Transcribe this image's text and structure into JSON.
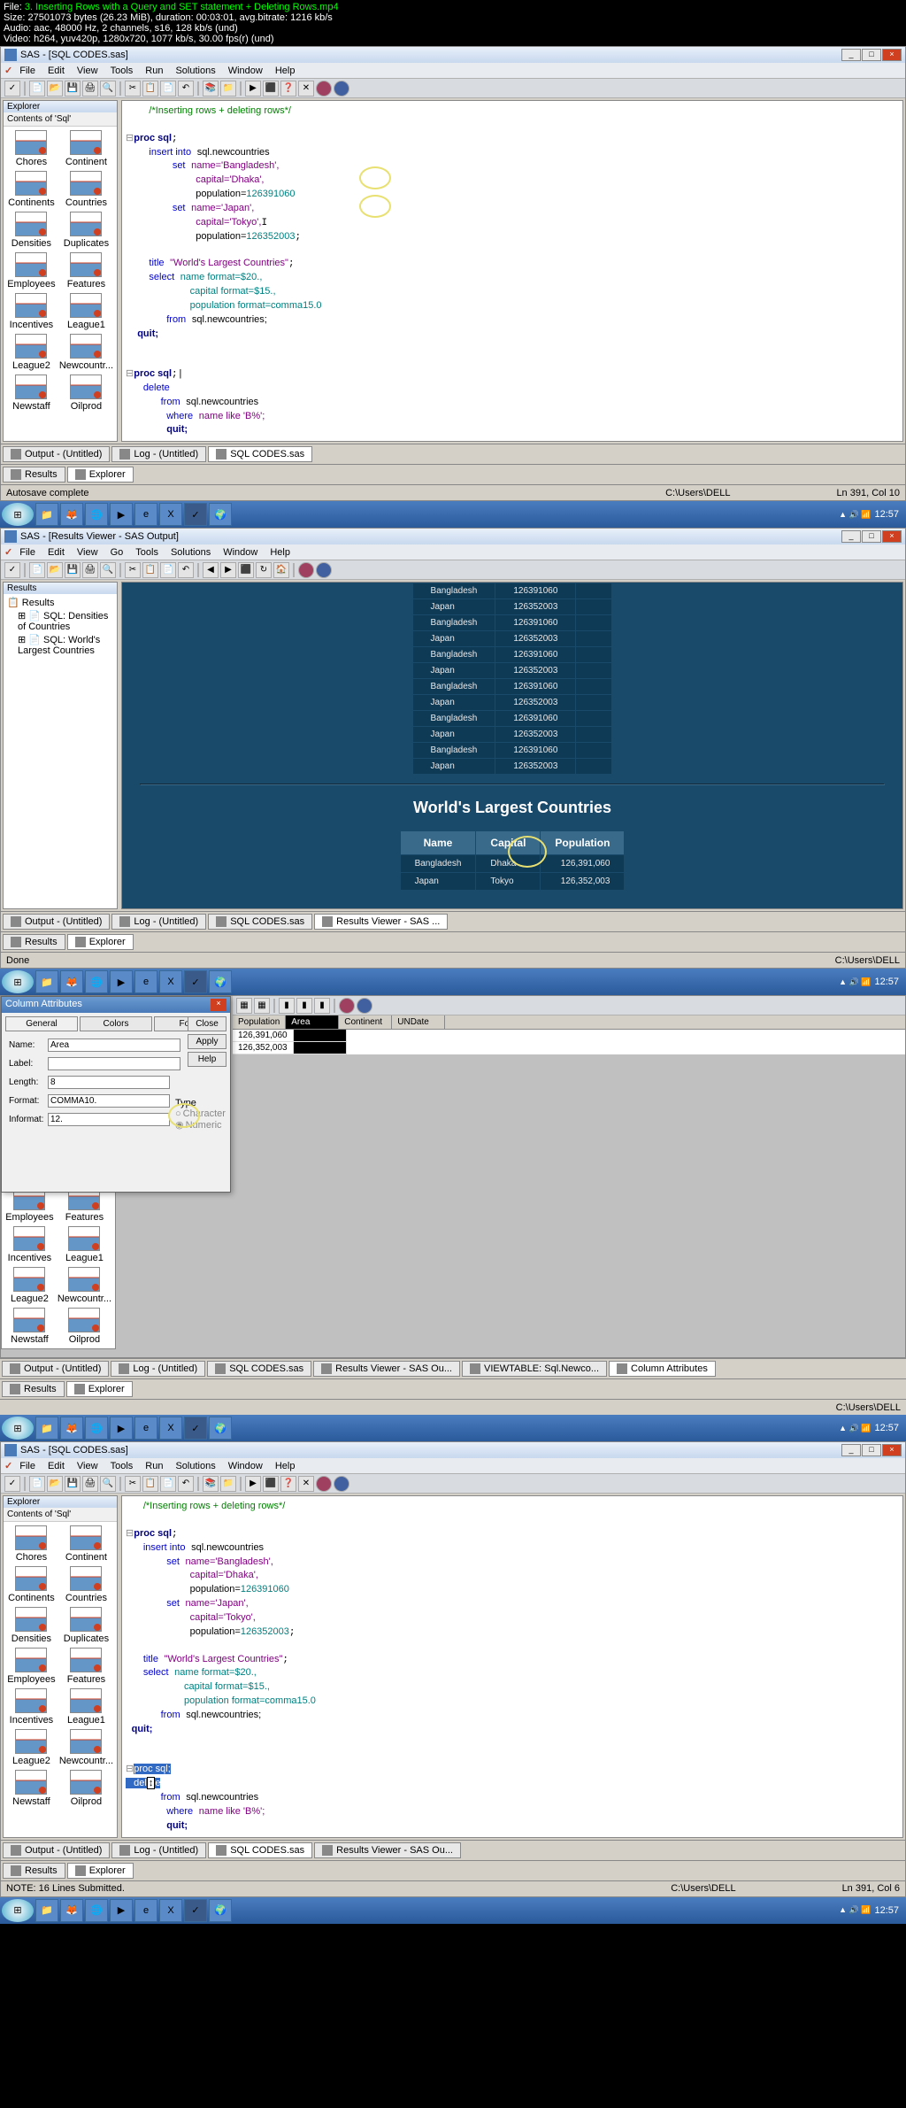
{
  "file_info": {
    "file": "3. Inserting Rows with a Query and SET statement + Deleting Rows.mp4",
    "size": "27501073 bytes (26.23 MiB), duration: 00:03:01, avg.bitrate: 1216 kb/s",
    "audio": "aac, 48000 Hz, 2 channels, s16, 128 kb/s (und)",
    "video": "h264, yuv420p, 1280x720, 1077 kb/s, 30.00 fps(r) (und)"
  },
  "app": {
    "title": "SAS - [SQL CODES.sas]",
    "title_results": "SAS - [Results Viewer - SAS Output]",
    "menus": [
      "File",
      "Edit",
      "View",
      "Tools",
      "Run",
      "Solutions",
      "Window",
      "Help"
    ],
    "menus_results": [
      "File",
      "Edit",
      "View",
      "Go",
      "Tools",
      "Solutions",
      "Window",
      "Help"
    ]
  },
  "explorer": {
    "title": "Explorer",
    "subtitle": "Contents of 'Sql'",
    "items": [
      "Chores",
      "Continent",
      "Continents",
      "Countries",
      "Densities",
      "Duplicates",
      "Employees",
      "Features",
      "Incentives",
      "League1",
      "League2",
      "Newcountr...",
      "Newstaff",
      "Oilprod"
    ]
  },
  "results_pane": {
    "title": "Results",
    "root": "Results",
    "nodes": [
      "SQL: Densities of Countries",
      "SQL: World's Largest Countries"
    ]
  },
  "code": {
    "c1": "/*Inserting rows + deleting rows*/",
    "proc": "proc sql",
    "insert": "insert into",
    "tbl": "sql.newcountries",
    "set": "set",
    "name1": "name='Bangladesh',",
    "cap1": "capital='Dhaka',",
    "pop1a": "population=",
    "pop1b": "126391060",
    "name2": "name='Japan',",
    "cap2": "capital='Tokyo',",
    "pop2a": "population=",
    "pop2b": "126352003",
    "titlek": "title",
    "titlev": "\"World's Largest Countries\"",
    "select": "select",
    "fmt_name": "name format=$20.,",
    "fmt_cap": "capital format=$15.,",
    "fmt_pop": "population format=comma15.0",
    "from": "from",
    "from_tbl": "sql.newcountries;",
    "quit": "quit;",
    "delete": "delete",
    "where": "where",
    "where_cond": "name like 'B%';",
    "cursor_note": "|"
  },
  "output_data": {
    "rows": [
      [
        "Bangladesh",
        "126391060"
      ],
      [
        "Japan",
        "126352003"
      ],
      [
        "Bangladesh",
        "126391060"
      ],
      [
        "Japan",
        "126352003"
      ],
      [
        "Bangladesh",
        "126391060"
      ],
      [
        "Japan",
        "126352003"
      ],
      [
        "Bangladesh",
        "126391060"
      ],
      [
        "Japan",
        "126352003"
      ],
      [
        "Bangladesh",
        "126391060"
      ],
      [
        "Japan",
        "126352003"
      ],
      [
        "Bangladesh",
        "126391060"
      ],
      [
        "Japan",
        "126352003"
      ]
    ],
    "wlc_title": "World's Largest Countries",
    "wlc_headers": [
      "Name",
      "Capital",
      "Population"
    ],
    "wlc_rows": [
      [
        "Bangladesh",
        "Dhaka",
        "126,391,060"
      ],
      [
        "Japan",
        "Tokyo",
        "126,352,003"
      ]
    ]
  },
  "col_attr": {
    "title": "Column Attributes",
    "tabs": [
      "General",
      "Colors",
      "Fonts"
    ],
    "name_lbl": "Name:",
    "name_val": "Area",
    "label_lbl": "Label:",
    "label_val": "",
    "length_lbl": "Length:",
    "length_val": "8",
    "format_lbl": "Format:",
    "format_val": "COMMA10.",
    "informat_lbl": "Informat:",
    "informat_val": "12.",
    "type_lbl": "Type",
    "type_char": "Character",
    "type_num": "Numeric",
    "btn_close": "Close",
    "btn_apply": "Apply",
    "btn_help": "Help"
  },
  "data_view": {
    "cols": [
      "Population",
      "Area",
      "Continent",
      "UNDate"
    ],
    "rows": [
      [
        "126,391,060",
        ""
      ],
      [
        "126,352,003",
        ""
      ]
    ]
  },
  "tabs": {
    "output": "Output - (Untitled)",
    "log": "Log - (Untitled)",
    "sql": "SQL CODES.sas",
    "results_viewer": "Results Viewer - SAS ...",
    "results_viewer2": "Results Viewer - SAS Ou...",
    "viewtable": "VIEWTABLE: Sql.Newco...",
    "col_attr": "Column Attributes",
    "btm_results": "Results",
    "btm_explorer": "Explorer"
  },
  "status": {
    "autosave": "Autosave complete",
    "done": "Done",
    "note_lines": "NOTE: 16 Lines Submitted.",
    "path": "C:\\Users\\DELL",
    "pos1": "Ln 391, Col 10",
    "pos4": "Ln 391, Col 6",
    "time": "12:57"
  }
}
